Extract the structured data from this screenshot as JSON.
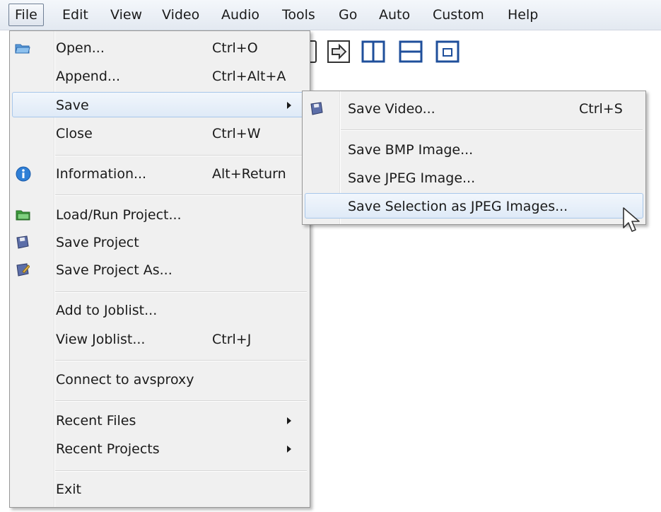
{
  "menubar": {
    "items": [
      "File",
      "Edit",
      "View",
      "Video",
      "Audio",
      "Tools",
      "Go",
      "Auto",
      "Custom",
      "Help"
    ]
  },
  "file_menu": {
    "items": [
      {
        "label": "Open...",
        "shortcut": "Ctrl+O",
        "icon": "open-folder-icon"
      },
      {
        "label": "Append...",
        "shortcut": "Ctrl+Alt+A"
      },
      {
        "label": "Save",
        "submenu": true
      },
      {
        "label": "Close",
        "shortcut": "Ctrl+W"
      },
      {
        "label": "Information...",
        "shortcut": "Alt+Return",
        "icon": "info-icon"
      },
      {
        "label": "Load/Run Project...",
        "icon": "project-folder-icon"
      },
      {
        "label": "Save Project",
        "icon": "floppy-disk-icon"
      },
      {
        "label": "Save Project As...",
        "icon": "floppy-disk-edit-icon"
      },
      {
        "label": "Add to Joblist..."
      },
      {
        "label": "View Joblist...",
        "shortcut": "Ctrl+J"
      },
      {
        "label": "Connect to avsproxy"
      },
      {
        "label": "Recent Files",
        "submenu": true
      },
      {
        "label": "Recent Projects",
        "submenu": true
      },
      {
        "label": "Exit"
      }
    ]
  },
  "save_submenu": {
    "items": [
      {
        "label": "Save Video...",
        "shortcut": "Ctrl+S",
        "icon": "floppy-disk-icon"
      },
      {
        "label": "Save BMP Image..."
      },
      {
        "label": "Save JPEG Image..."
      },
      {
        "label": "Save Selection as JPEG Images..."
      }
    ]
  },
  "colors": {
    "highlight_border": "#a8c7ea",
    "menu_background": "#f0f0f0",
    "toolbar_icon": "#1f4f9b"
  }
}
